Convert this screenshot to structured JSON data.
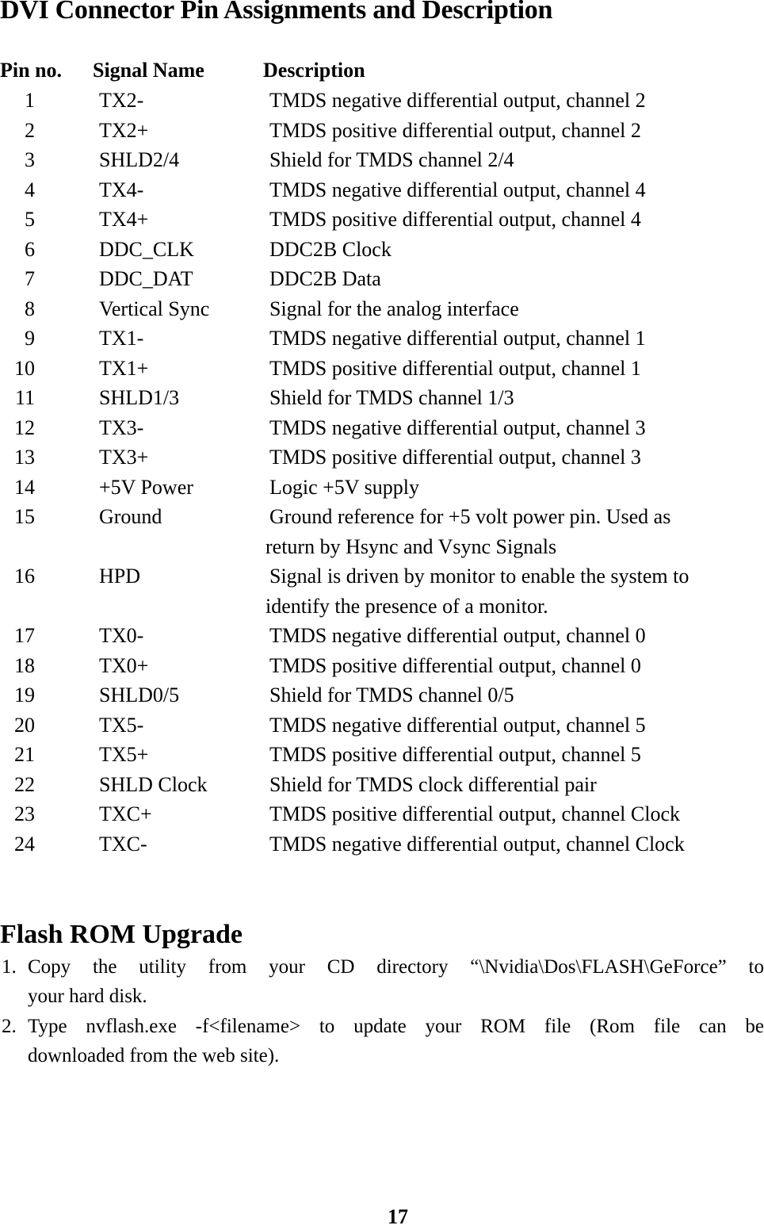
{
  "title": "DVI Connector Pin Assignments and Description",
  "table": {
    "headers": {
      "pin": "Pin no.",
      "signal": "Signal Name",
      "description": "Description"
    },
    "rows": [
      {
        "pin": "1",
        "signal": "TX2-",
        "description": "TMDS negative differential output, channel 2",
        "continuation": ""
      },
      {
        "pin": "2",
        "signal": "TX2+",
        "description": "TMDS positive differential output, channel 2",
        "continuation": ""
      },
      {
        "pin": "3",
        "signal": "SHLD2/4",
        "description": "Shield for TMDS channel 2/4",
        "continuation": ""
      },
      {
        "pin": "4",
        "signal": "TX4-",
        "description": "TMDS negative differential output, channel 4",
        "continuation": ""
      },
      {
        "pin": "5",
        "signal": "TX4+",
        "description": "TMDS positive differential output, channel 4",
        "continuation": ""
      },
      {
        "pin": "6",
        "signal": "DDC_CLK",
        "description": "DDC2B Clock",
        "continuation": ""
      },
      {
        "pin": "7",
        "signal": "DDC_DAT",
        "description": "DDC2B Data",
        "continuation": ""
      },
      {
        "pin": "8",
        "signal": "Vertical Sync",
        "description": "Signal for the analog interface",
        "continuation": ""
      },
      {
        "pin": "9",
        "signal": "TX1-",
        "description": "TMDS negative differential output, channel 1",
        "continuation": ""
      },
      {
        "pin": "10",
        "signal": "TX1+",
        "description": "TMDS positive differential output, channel 1",
        "continuation": ""
      },
      {
        "pin": "11",
        "signal": "SHLD1/3",
        "description": "Shield for TMDS channel 1/3",
        "continuation": ""
      },
      {
        "pin": "12",
        "signal": "TX3-",
        "description": "TMDS negative differential output, channel 3",
        "continuation": ""
      },
      {
        "pin": "13",
        "signal": "TX3+",
        "description": "TMDS positive differential output, channel 3",
        "continuation": ""
      },
      {
        "pin": "14",
        "signal": "+5V Power",
        "description": "Logic +5V supply",
        "continuation": ""
      },
      {
        "pin": "15",
        "signal": "Ground",
        "description": "Ground reference for +5 volt power pin. Used as",
        "continuation": "return by Hsync and Vsync Signals"
      },
      {
        "pin": "16",
        "signal": "HPD",
        "description": "Signal is driven by monitor to enable the system to",
        "continuation": "identify the presence of a monitor."
      },
      {
        "pin": "17",
        "signal": "TX0-",
        "description": "TMDS negative differential output, channel 0",
        "continuation": ""
      },
      {
        "pin": "18",
        "signal": "TX0+",
        "description": "TMDS positive differential output, channel 0",
        "continuation": ""
      },
      {
        "pin": "19",
        "signal": "SHLD0/5",
        "description": "Shield for TMDS channel 0/5",
        "continuation": ""
      },
      {
        "pin": "20",
        "signal": "TX5-",
        "description": "TMDS negative differential output, channel 5",
        "continuation": ""
      },
      {
        "pin": "21",
        "signal": "TX5+",
        "description": "TMDS positive differential output, channel 5",
        "continuation": ""
      },
      {
        "pin": "22",
        "signal": "SHLD Clock",
        "description": "Shield for TMDS clock differential pair",
        "continuation": ""
      },
      {
        "pin": "23",
        "signal": "TXC+",
        "description": "TMDS positive differential output, channel Clock",
        "continuation": ""
      },
      {
        "pin": "24",
        "signal": "TXC-",
        "description": "TMDS negative differential output, channel Clock",
        "continuation": ""
      }
    ]
  },
  "flash": {
    "title": "Flash ROM Upgrade",
    "steps": [
      {
        "num": "1.",
        "line1": "Copy the utility from your CD directory “\\Nvidia\\Dos\\FLASH\\GeForce” to",
        "line2": "your hard disk."
      },
      {
        "num": "2.",
        "line1": "Type nvflash.exe -f<filename> to update your ROM file (Rom file can be",
        "line2": "downloaded from the web site)."
      }
    ]
  },
  "page_number": "17"
}
